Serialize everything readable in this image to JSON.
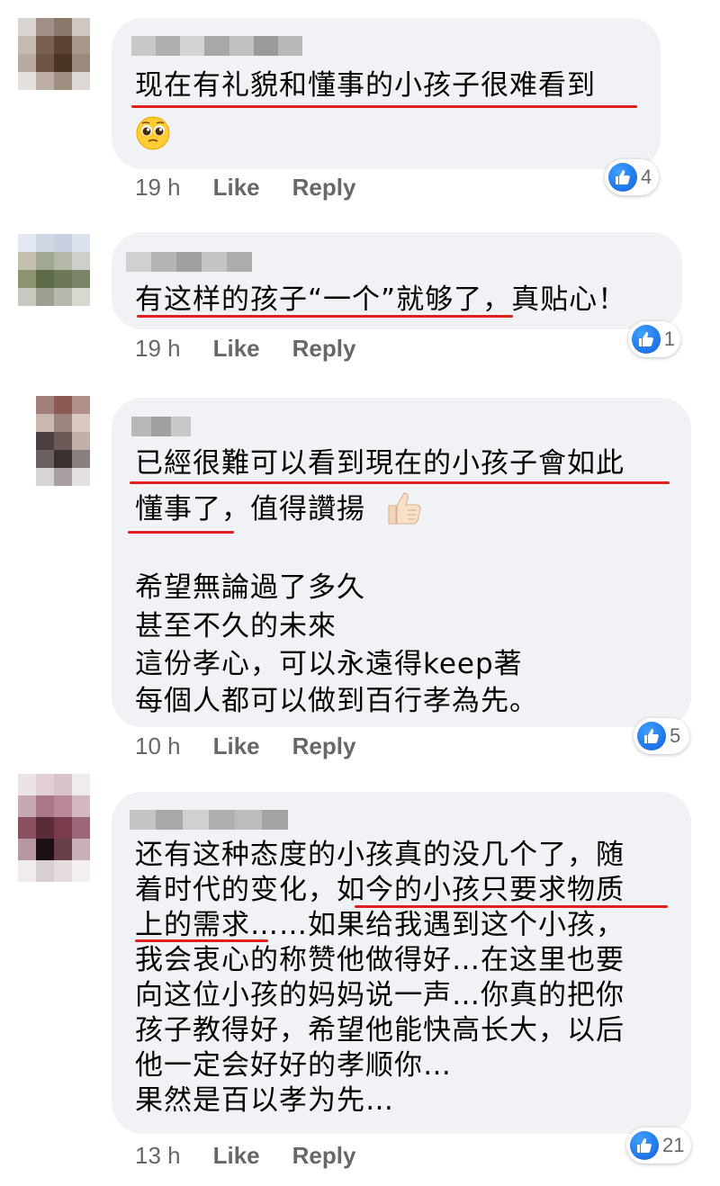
{
  "comments": [
    {
      "lines": [
        "现在有礼貌和懂事的小孩子很难看到"
      ],
      "time": "19 h",
      "like_label": "Like",
      "reply_label": "Reply",
      "reactions": "4",
      "emoji": "pleading-face"
    },
    {
      "lines": [
        "有这样的孩子“一个”就够了，真贴心！"
      ],
      "time": "19 h",
      "like_label": "Like",
      "reply_label": "Reply",
      "reactions": "1"
    },
    {
      "lines": [
        "已經很難可以看到現在的小孩子會如此",
        "懂事了，值得讚揚",
        "希望無論過了多久",
        "甚至不久的未來",
        "這份孝心，可以永遠得keep著",
        "每個人都可以做到百行孝為先。"
      ],
      "time": "10 h",
      "like_label": "Like",
      "reply_label": "Reply",
      "reactions": "5",
      "emoji": "thumbs-up-light-skin"
    },
    {
      "lines": [
        "还有这种态度的小孩真的没几个了，随",
        "着时代的变化，如今的小孩只要求物质",
        "上的需求……如果给我遇到这个小孩，",
        "我会衷心的称赞他做得好…在这里也要",
        "向这位小孩的妈妈说一声…你真的把你",
        "孩子教得好，希望他能快高长大，以后",
        "他一定会好好的孝顺你…",
        "果然是百以孝为先…"
      ],
      "time": "13 h",
      "like_label": "Like",
      "reply_label": "Reply",
      "reactions": "21"
    }
  ],
  "colors": {
    "bubble": "#f0f2f5",
    "underline": "#e0201e",
    "like_blue": "#1877f2",
    "meta_gray": "#65676b"
  }
}
